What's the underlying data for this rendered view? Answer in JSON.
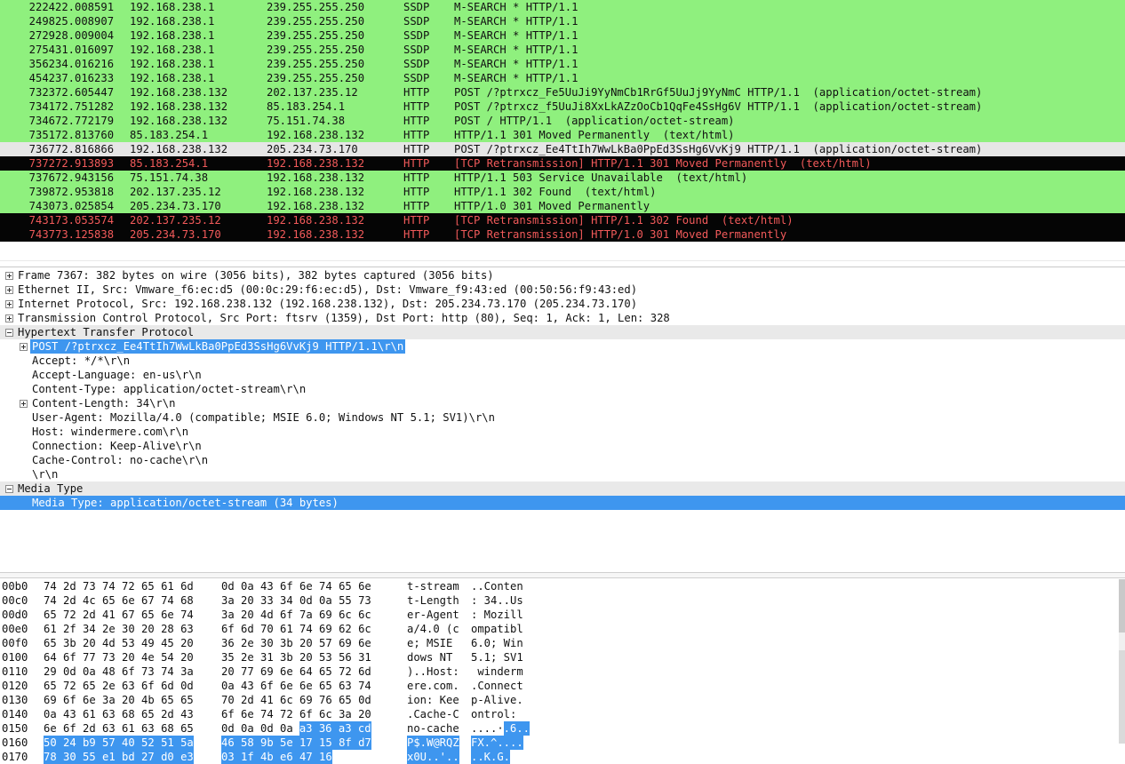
{
  "packets": [
    {
      "no": "2224",
      "time": "22.008591",
      "src": "192.168.238.1",
      "dst": "239.255.255.250",
      "proto": "SSDP",
      "info": "M-SEARCH * HTTP/1.1",
      "style": "green"
    },
    {
      "no": "2498",
      "time": "25.008907",
      "src": "192.168.238.1",
      "dst": "239.255.255.250",
      "proto": "SSDP",
      "info": "M-SEARCH * HTTP/1.1",
      "style": "green"
    },
    {
      "no": "2729",
      "time": "28.009004",
      "src": "192.168.238.1",
      "dst": "239.255.255.250",
      "proto": "SSDP",
      "info": "M-SEARCH * HTTP/1.1",
      "style": "green"
    },
    {
      "no": "2754",
      "time": "31.016097",
      "src": "192.168.238.1",
      "dst": "239.255.255.250",
      "proto": "SSDP",
      "info": "M-SEARCH * HTTP/1.1",
      "style": "green"
    },
    {
      "no": "3562",
      "time": "34.016216",
      "src": "192.168.238.1",
      "dst": "239.255.255.250",
      "proto": "SSDP",
      "info": "M-SEARCH * HTTP/1.1",
      "style": "green"
    },
    {
      "no": "4542",
      "time": "37.016233",
      "src": "192.168.238.1",
      "dst": "239.255.255.250",
      "proto": "SSDP",
      "info": "M-SEARCH * HTTP/1.1",
      "style": "green"
    },
    {
      "no": "7323",
      "time": "72.605447",
      "src": "192.168.238.132",
      "dst": "202.137.235.12",
      "proto": "HTTP",
      "info": "POST /?ptrxcz_Fe5UuJi9YyNmCb1RrGf5UuJj9YyNmC HTTP/1.1  (application/octet-stream)",
      "style": "green"
    },
    {
      "no": "7341",
      "time": "72.751282",
      "src": "192.168.238.132",
      "dst": "85.183.254.1",
      "proto": "HTTP",
      "info": "POST /?ptrxcz_f5UuJi8XxLkAZzOoCb1QqFe4SsHg6V HTTP/1.1  (application/octet-stream)",
      "style": "green"
    },
    {
      "no": "7346",
      "time": "72.772179",
      "src": "192.168.238.132",
      "dst": "75.151.74.38",
      "proto": "HTTP",
      "info": "POST / HTTP/1.1  (application/octet-stream)",
      "style": "green"
    },
    {
      "no": "7351",
      "time": "72.813760",
      "src": "85.183.254.1",
      "dst": "192.168.238.132",
      "proto": "HTTP",
      "info": "HTTP/1.1 301 Moved Permanently  (text/html)",
      "style": "green"
    },
    {
      "no": "7367",
      "time": "72.816866",
      "src": "192.168.238.132",
      "dst": "205.234.73.170",
      "proto": "HTTP",
      "info": "POST /?ptrxcz_Ee4TtIh7WwLkBa0PpEd3SsHg6VvKj9 HTTP/1.1  (application/octet-stream)",
      "style": "selected"
    },
    {
      "no": "7372",
      "time": "72.913893",
      "src": "85.183.254.1",
      "dst": "192.168.238.132",
      "proto": "HTTP",
      "info": "[TCP Retransmission] HTTP/1.1 301 Moved Permanently  (text/html)",
      "style": "black"
    },
    {
      "no": "7376",
      "time": "72.943156",
      "src": "75.151.74.38",
      "dst": "192.168.238.132",
      "proto": "HTTP",
      "info": "HTTP/1.1 503 Service Unavailable  (text/html)",
      "style": "green"
    },
    {
      "no": "7398",
      "time": "72.953818",
      "src": "202.137.235.12",
      "dst": "192.168.238.132",
      "proto": "HTTP",
      "info": "HTTP/1.1 302 Found  (text/html)",
      "style": "green"
    },
    {
      "no": "7430",
      "time": "73.025854",
      "src": "205.234.73.170",
      "dst": "192.168.238.132",
      "proto": "HTTP",
      "info": "HTTP/1.0 301 Moved Permanently",
      "style": "green"
    },
    {
      "no": "7431",
      "time": "73.053574",
      "src": "202.137.235.12",
      "dst": "192.168.238.132",
      "proto": "HTTP",
      "info": "[TCP Retransmission] HTTP/1.1 302 Found  (text/html)",
      "style": "black"
    },
    {
      "no": "7437",
      "time": "73.125838",
      "src": "205.234.73.170",
      "dst": "192.168.238.132",
      "proto": "HTTP",
      "info": "[TCP Retransmission] HTTP/1.0 301 Moved Permanently",
      "style": "black"
    }
  ],
  "details": [
    {
      "text": "Frame 7367: 382 bytes on wire (3056 bits), 382 bytes captured (3056 bits)",
      "level": 0,
      "expander": "plus",
      "style": "plain"
    },
    {
      "text": "Ethernet II, Src: Vmware_f6:ec:d5 (00:0c:29:f6:ec:d5), Dst: Vmware_f9:43:ed (00:50:56:f9:43:ed)",
      "level": 0,
      "expander": "plus",
      "style": "plain"
    },
    {
      "text": "Internet Protocol, Src: 192.168.238.132 (192.168.238.132), Dst: 205.234.73.170 (205.234.73.170)",
      "level": 0,
      "expander": "plus",
      "style": "plain"
    },
    {
      "text": "Transmission Control Protocol, Src Port: ftsrv (1359), Dst Port: http (80), Seq: 1, Ack: 1, Len: 328",
      "level": 0,
      "expander": "plus",
      "style": "plain"
    },
    {
      "text": "Hypertext Transfer Protocol",
      "level": 0,
      "expander": "minus",
      "style": "header"
    },
    {
      "text": "POST /?ptrxcz_Ee4TtIh7WwLkBa0PpEd3SsHg6VvKj9 HTTP/1.1\\r\\n",
      "level": 1,
      "expander": "plus",
      "style": "selected"
    },
    {
      "text": "Accept: */*\\r\\n",
      "level": 1,
      "expander": "none",
      "style": "plain"
    },
    {
      "text": "Accept-Language: en-us\\r\\n",
      "level": 1,
      "expander": "none",
      "style": "plain"
    },
    {
      "text": "Content-Type: application/octet-stream\\r\\n",
      "level": 1,
      "expander": "none",
      "style": "plain"
    },
    {
      "text": "Content-Length: 34\\r\\n",
      "level": 1,
      "expander": "plus",
      "style": "plain"
    },
    {
      "text": "User-Agent: Mozilla/4.0 (compatible; MSIE 6.0; Windows NT 5.1; SV1)\\r\\n",
      "level": 1,
      "expander": "none",
      "style": "plain"
    },
    {
      "text": "Host: windermere.com\\r\\n",
      "level": 1,
      "expander": "none",
      "style": "plain"
    },
    {
      "text": "Connection: Keep-Alive\\r\\n",
      "level": 1,
      "expander": "none",
      "style": "plain"
    },
    {
      "text": "Cache-Control: no-cache\\r\\n",
      "level": 1,
      "expander": "none",
      "style": "plain"
    },
    {
      "text": "\\r\\n",
      "level": 1,
      "expander": "none",
      "style": "plain"
    },
    {
      "text": "Media Type",
      "level": 0,
      "expander": "minus",
      "style": "header"
    },
    {
      "text": "Media Type: application/octet-stream (34 bytes)",
      "level": 1,
      "expander": "none",
      "style": "selected-full"
    }
  ],
  "hex": [
    {
      "off": "00b0",
      "a": "74 2d 73 74 72 65 61 6d",
      "b": "0d 0a 43 6f 6e 74 65 6e",
      "ascii_a": "t-stream",
      "ascii_b": "..Conten"
    },
    {
      "off": "00c0",
      "a": "74 2d 4c 65 6e 67 74 68",
      "b": "3a 20 33 34 0d 0a 55 73",
      "ascii_a": "t-Length",
      "ascii_b": ": 34..Us"
    },
    {
      "off": "00d0",
      "a": "65 72 2d 41 67 65 6e 74",
      "b": "3a 20 4d 6f 7a 69 6c 6c",
      "ascii_a": "er-Agent",
      "ascii_b": ": Mozill"
    },
    {
      "off": "00e0",
      "a": "61 2f 34 2e 30 20 28 63",
      "b": "6f 6d 70 61 74 69 62 6c",
      "ascii_a": "a/4.0 (c",
      "ascii_b": "ompatibl"
    },
    {
      "off": "00f0",
      "a": "65 3b 20 4d 53 49 45 20",
      "b": "36 2e 30 3b 20 57 69 6e",
      "ascii_a": "e; MSIE ",
      "ascii_b": "6.0; Win"
    },
    {
      "off": "0100",
      "a": "64 6f 77 73 20 4e 54 20",
      "b": "35 2e 31 3b 20 53 56 31",
      "ascii_a": "dows NT ",
      "ascii_b": "5.1; SV1"
    },
    {
      "off": "0110",
      "a": "29 0d 0a 48 6f 73 74 3a",
      "b": "20 77 69 6e 64 65 72 6d",
      "ascii_a": ")..Host:",
      "ascii_b": " winderm"
    },
    {
      "off": "0120",
      "a": "65 72 65 2e 63 6f 6d 0d",
      "b": "0a 43 6f 6e 6e 65 63 74",
      "ascii_a": "ere.com.",
      "ascii_b": ".Connect"
    },
    {
      "off": "0130",
      "a": "69 6f 6e 3a 20 4b 65 65",
      "b": "70 2d 41 6c 69 76 65 0d",
      "ascii_a": "ion: Kee",
      "ascii_b": "p-Alive."
    },
    {
      "off": "0140",
      "a": "0a 43 61 63 68 65 2d 43",
      "b": "6f 6e 74 72 6f 6c 3a 20",
      "ascii_a": ".Cache-C",
      "ascii_b": "ontrol: "
    },
    {
      "off": "0150",
      "a": "6e 6f 2d 63 61 63 68 65",
      "b": "0d 0a 0d 0a a3 36 a3 cd",
      "ascii_a": "no-cache",
      "ascii_b": "....·.6..",
      "selB": "a3 36 a3 cd",
      "asciiSelB": ".6.."
    },
    {
      "off": "0160",
      "a": "50 24 b9 57 40 52 51 5a",
      "b": "46 58 9b 5e 17 15 8f d7",
      "ascii_a": "P$.W@RQZ",
      "ascii_b": "FX.^....",
      "fullSel": true
    },
    {
      "off": "0170",
      "a": "78 30 55 e1 bd 27 d0 e3",
      "b": "03 1f 4b e6 47 16",
      "ascii_a": "x0U..'..",
      "ascii_b": "..K.G.",
      "fullSel": true
    }
  ]
}
